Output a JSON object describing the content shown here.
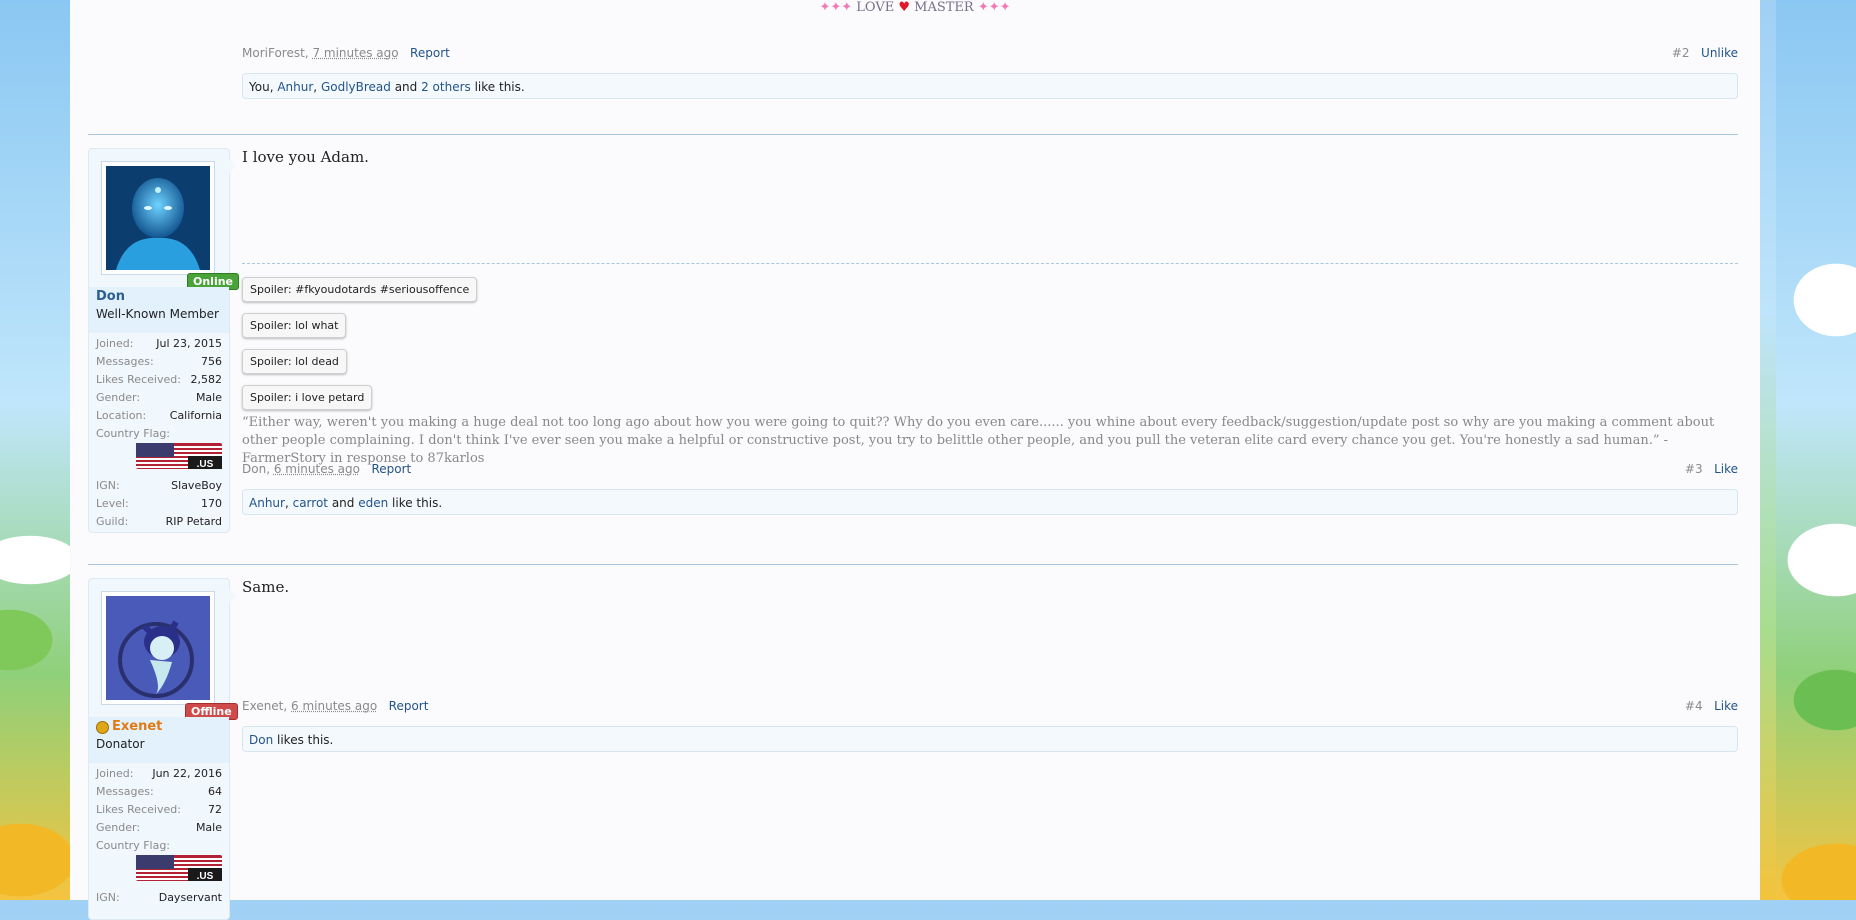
{
  "signature_top": {
    "left_sparks": "✦✦✦",
    "text_before": "LOVE",
    "heart": "♥",
    "text_after": "MASTER",
    "right_sparks": "✦✦✦"
  },
  "post2": {
    "author": "MoriForest",
    "time": "7 minutes ago",
    "report": "Report",
    "number": "#2",
    "like_action": "Unlike",
    "likes": {
      "you": "You",
      "sep1": ", ",
      "u1": "Anhur",
      "sep2": ", ",
      "u2": "GodlyBread",
      "and": " and ",
      "others": "2 others",
      "suffix": " like this."
    }
  },
  "post3": {
    "user": {
      "name": "Don",
      "title": "Well-Known Member",
      "status": "Online",
      "stats": [
        {
          "k": "Joined:",
          "v": "Jul 23, 2015"
        },
        {
          "k": "Messages:",
          "v": "756"
        },
        {
          "k": "Likes Received:",
          "v": "2,582"
        },
        {
          "k": "Gender:",
          "v": "Male"
        },
        {
          "k": "Location:",
          "v": "California"
        }
      ],
      "country_flag_label": "Country Flag:",
      "flag_text": ".US",
      "stats2": [
        {
          "k": "IGN:",
          "v": "SlaveBoy"
        },
        {
          "k": "Level:",
          "v": "170"
        },
        {
          "k": "Guild:",
          "v": "RIP Petard"
        }
      ]
    },
    "text": "I love you Adam.",
    "spoilers": [
      "Spoiler: #fkyoudotards #seriousoffence",
      "Spoiler: lol what",
      "Spoiler: lol dead",
      "Spoiler: i love petard"
    ],
    "quote": "“Either way, weren't you making a huge deal not too long ago about how you were going to quit?? Why do you even care...... you whine about every feedback/suggestion/update post so why are you making a comment about other people complaining. I don't think I've ever seen you make a helpful or constructive post, you try to belittle other people, and you pull the veteran elite card every chance you get. You're honestly a sad human.” -FarmerStory in response to 87karlos",
    "author": "Don",
    "time": "6 minutes ago",
    "report": "Report",
    "number": "#3",
    "like_action": "Like",
    "likes": {
      "u1": "Anhur",
      "sep1": ", ",
      "u2": "carrot",
      "and": " and ",
      "u3": "eden",
      "suffix": " like this."
    }
  },
  "post4": {
    "user": {
      "name": "Exenet",
      "title": "Donator",
      "status": "Offline",
      "stats": [
        {
          "k": "Joined:",
          "v": "Jun 22, 2016"
        },
        {
          "k": "Messages:",
          "v": "64"
        },
        {
          "k": "Likes Received:",
          "v": "72"
        },
        {
          "k": "Gender:",
          "v": "Male"
        }
      ],
      "country_flag_label": "Country Flag:",
      "flag_text": ".US",
      "stats2": [
        {
          "k": "IGN:",
          "v": "Dayservant"
        }
      ]
    },
    "text": "Same.",
    "author": "Exenet",
    "time": "6 minutes ago",
    "report": "Report",
    "number": "#4",
    "like_action": "Like",
    "likes": {
      "u1": "Don",
      "suffix": " likes this."
    }
  },
  "colors": {
    "link": "#22548a",
    "online": "#4aa339",
    "offline": "#cf4b4b",
    "donator": "#e07b14"
  }
}
